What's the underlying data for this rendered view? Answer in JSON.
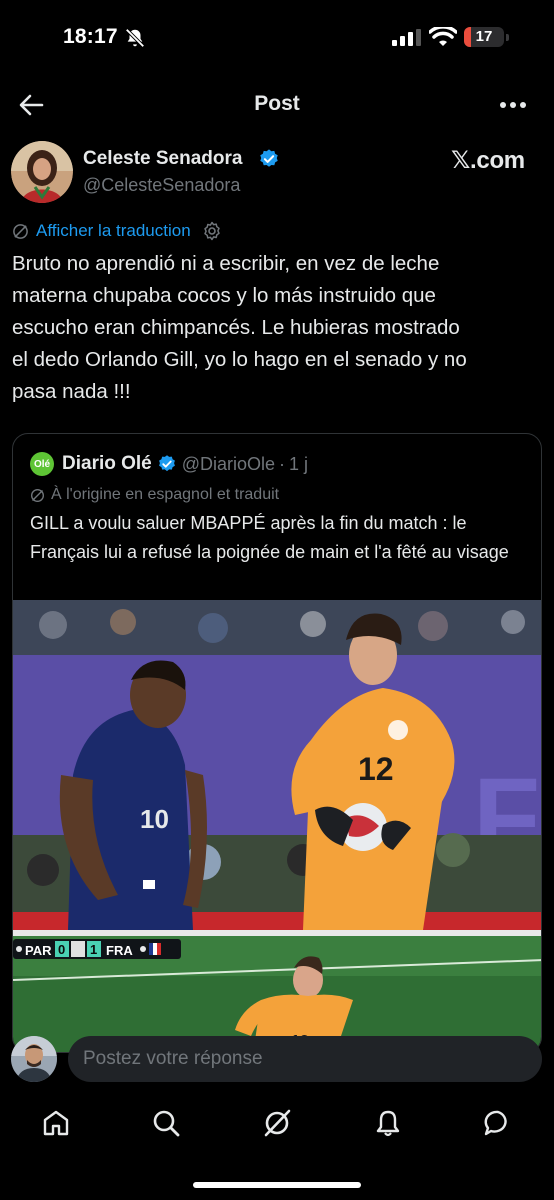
{
  "status_bar": {
    "time": "18:17",
    "battery": "17",
    "battery_level_fraction": 0.17,
    "icons": [
      "bell-slash-icon",
      "cellular-signal-icon",
      "wifi-icon",
      "battery-icon"
    ]
  },
  "header": {
    "title": "Post",
    "back_icon": "arrow-left-icon",
    "more_icon": "more-horizontal-icon"
  },
  "post": {
    "author_name": "Celeste Senadora",
    "author_handle": "@CelesteSenadora",
    "watermark": "𝕏.com",
    "translate_label": "Afficher la traduction",
    "text": "Bruto no aprendió ni a escribir, en vez de leche\nmaterna chupaba cocos y lo más instruido que\nescucho eran chimpancés. Le hubieras mostrado\nel dedo Orlando Gill, yo lo hago en el senado y no\npasa nada  !!!"
  },
  "quote": {
    "logo_text": "Olé",
    "name": "Diario Olé",
    "handle": "@DiarioOle",
    "separator": "·",
    "time": "1 j",
    "origin_note": "À l'origine en espagnol et traduit",
    "text": "GILL a voulu saluer MBAPPÉ après la fin du match : le Français lui a refusé la poignée de main et l'a fêté au visage",
    "scoreboard": {
      "home": "PAR",
      "home_score": "0",
      "away_score": "1",
      "away": "FRA"
    },
    "shirt_numbers": {
      "left_player": "10",
      "right_player": "12"
    }
  },
  "reply": {
    "placeholder": "Postez votre réponse"
  },
  "nav": {
    "items": [
      "home-icon",
      "search-icon",
      "grok-icon",
      "notifications-icon",
      "messages-icon"
    ]
  },
  "colors": {
    "background": "#000000",
    "text": "#e7e9ea",
    "muted": "#71767b",
    "link": "#1d9bf0",
    "verified": "#1d9bf0",
    "ole_green": "#5ec435",
    "battery_red": "#eb4d3d"
  }
}
